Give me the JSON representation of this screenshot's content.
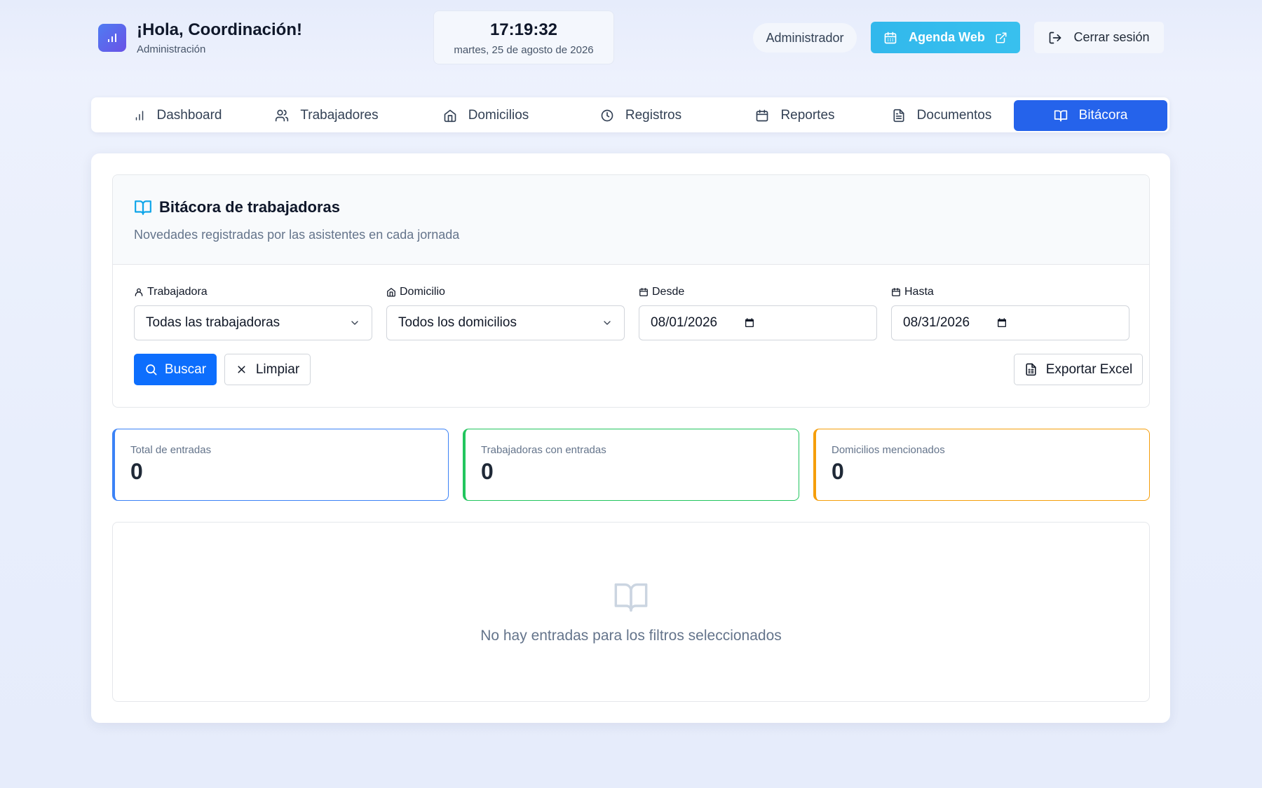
{
  "header": {
    "greeting": "¡Hola, Coordinación!",
    "subtitle": "Administración",
    "clock_time": "17:19:32",
    "clock_date": "martes, 25 de agosto de 2026",
    "role_badge": "Administrador",
    "agenda_label": "Agenda Web",
    "logout_label": "Cerrar sesión"
  },
  "nav": {
    "tabs": [
      {
        "label": "Dashboard",
        "icon": "bar-chart-icon"
      },
      {
        "label": "Trabajadores",
        "icon": "users-icon"
      },
      {
        "label": "Domicilios",
        "icon": "home-icon"
      },
      {
        "label": "Registros",
        "icon": "clock-icon"
      },
      {
        "label": "Reportes",
        "icon": "calendar-icon"
      },
      {
        "label": "Documentos",
        "icon": "document-icon"
      },
      {
        "label": "Bitácora",
        "icon": "book-icon"
      }
    ],
    "active_tab": "Bitácora"
  },
  "section": {
    "title": "Bitácora de trabajadoras",
    "subtitle": "Novedades registradas por las asistentes en cada jornada"
  },
  "filters": {
    "worker": {
      "label": "Trabajadora",
      "value": "Todas las trabajadoras"
    },
    "home": {
      "label": "Domicilio",
      "value": "Todos los domicilios"
    },
    "from": {
      "label": "Desde",
      "value": "08/01/2026"
    },
    "to": {
      "label": "Hasta",
      "value": "08/31/2026"
    }
  },
  "actions": {
    "search": "Buscar",
    "clear": "Limpiar",
    "export": "Exportar Excel"
  },
  "stats": [
    {
      "label": "Total de entradas",
      "value": "0",
      "color": "#3b82f6"
    },
    {
      "label": "Trabajadoras con entradas",
      "value": "0",
      "color": "#22c55e"
    },
    {
      "label": "Domicilios mencionados",
      "value": "0",
      "color": "#f59e0b"
    }
  ],
  "empty_state": {
    "message": "No hay entradas para los filtros seleccionados",
    "icon": "book-open-icon"
  },
  "colors": {
    "primary": "#2563eb",
    "search_button": "#0d6efd",
    "agenda_button": "#38bdf8"
  }
}
